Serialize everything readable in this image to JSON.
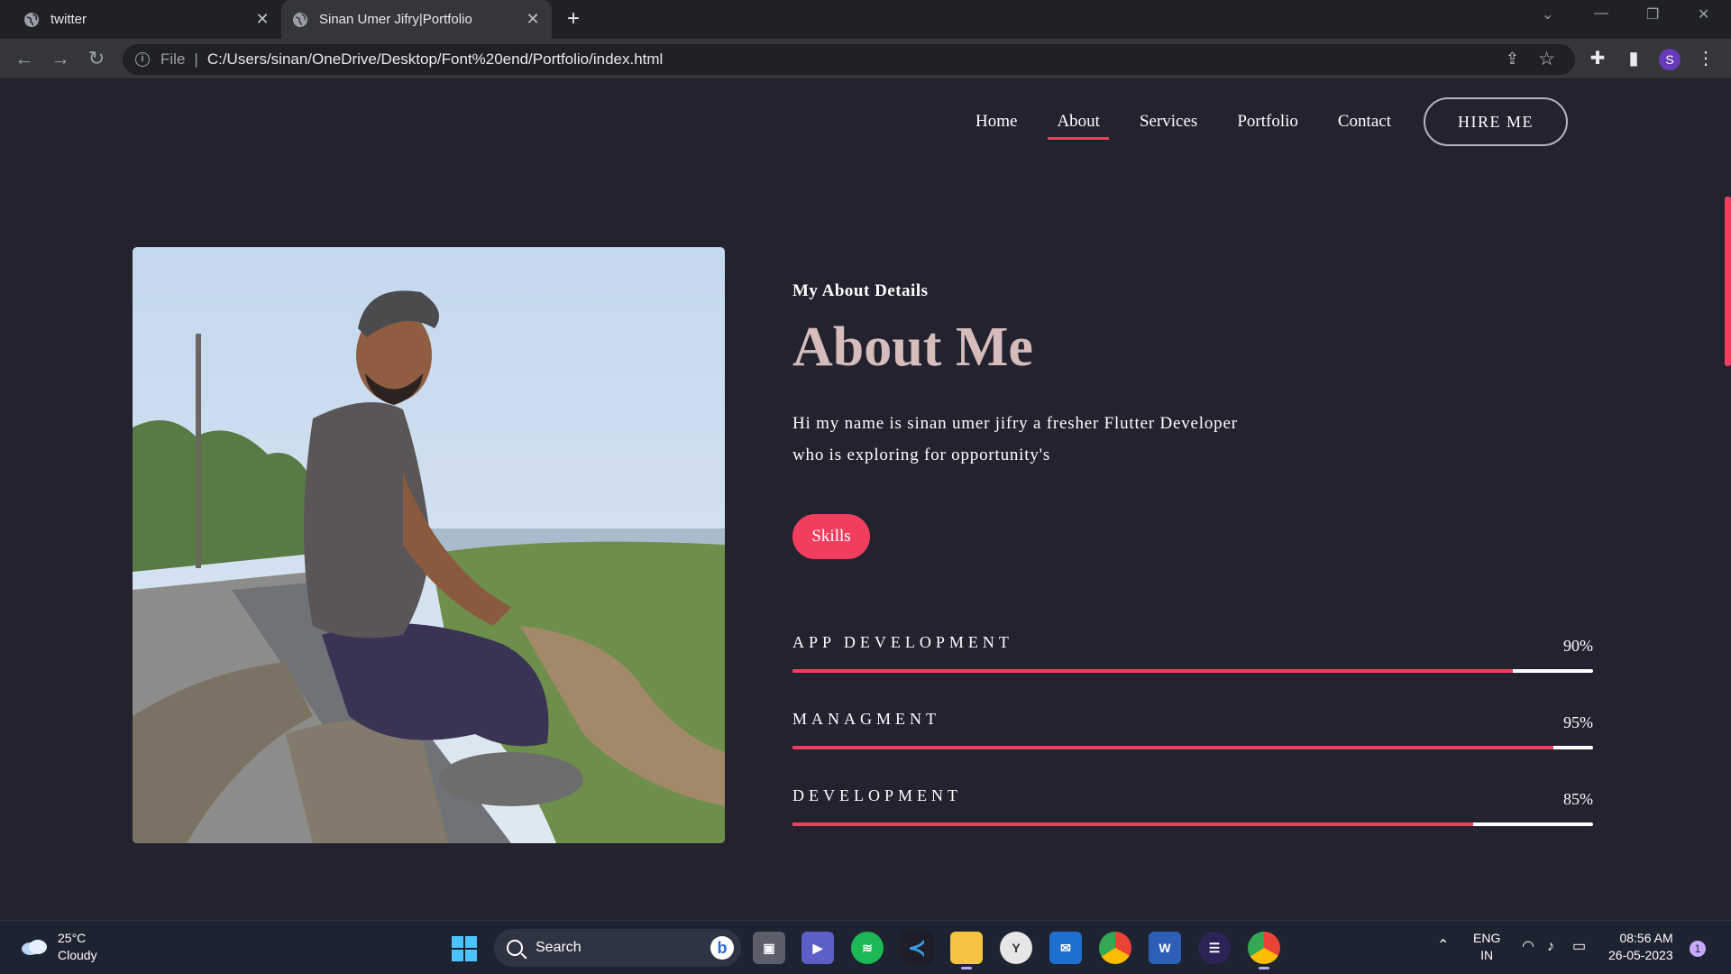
{
  "browser": {
    "tabs": [
      {
        "title": "twitter",
        "active": false
      },
      {
        "title": "Sinan Umer Jifry|Portfolio",
        "active": true
      }
    ],
    "omnibox": {
      "scheme_label": "File",
      "url": "C:/Users/sinan/OneDrive/Desktop/Font%20end/Portfolio/index.html"
    },
    "profile_initial": "S"
  },
  "site": {
    "nav": {
      "items": [
        "Home",
        "About",
        "Services",
        "Portfolio",
        "Contact"
      ],
      "active": "About",
      "hire_label": "HIRE ME"
    },
    "about": {
      "subtitle": "My About Details",
      "heading": "About Me",
      "bio_line1": "Hi my name is sinan umer jifry a fresher Flutter Developer",
      "bio_line2": "who is exploring for opportunity's",
      "skills_button": "Skills"
    },
    "skills": [
      {
        "name": "APP DEVELOPMENT",
        "percent_label": "90%",
        "value": 90
      },
      {
        "name": "MANAGMENT",
        "percent_label": "95%",
        "value": 95
      },
      {
        "name": "DEVELOPMENT",
        "percent_label": "85%",
        "value": 85
      }
    ],
    "colors": {
      "accent": "#f23e5e",
      "background": "#23222f",
      "heading": "#d7bcbc"
    }
  },
  "taskbar": {
    "weather": {
      "temp": "25°C",
      "condition": "Cloudy"
    },
    "search_placeholder": "Search",
    "language": {
      "line1": "ENG",
      "line2": "IN"
    },
    "clock": {
      "time": "08:56 AM",
      "date": "26-05-2023"
    },
    "notification_count": "1"
  }
}
